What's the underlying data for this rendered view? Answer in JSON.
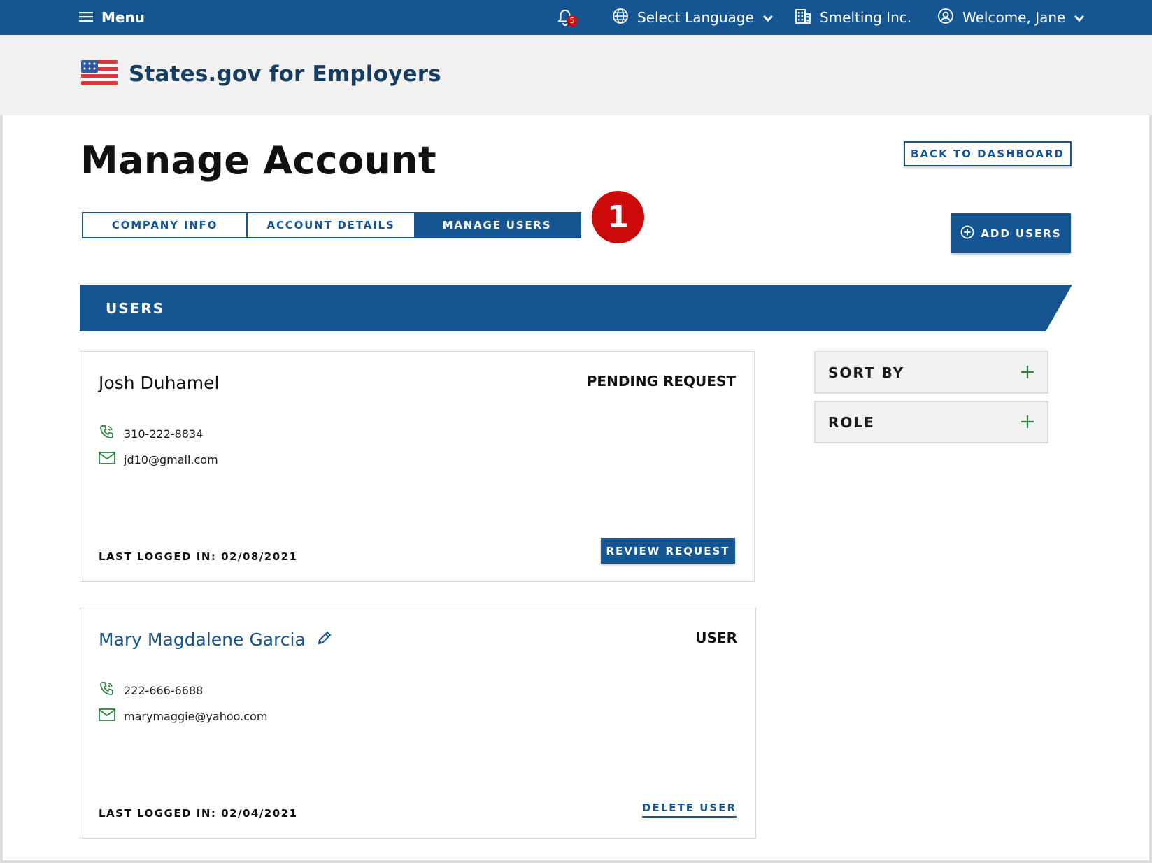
{
  "topbar": {
    "menu_label": "Menu",
    "notification_count": "5",
    "language_label": "Select Language",
    "company_label": "Smelting Inc.",
    "welcome_label": "Welcome, Jane"
  },
  "brand": {
    "title": "States.gov for Employers"
  },
  "page": {
    "title": "Manage Account",
    "back_button": "BACK TO DASHBOARD",
    "add_users_button": "ADD USERS",
    "step_marker": "1"
  },
  "tabs": [
    {
      "label": "COMPANY INFO",
      "active": false
    },
    {
      "label": "ACCOUNT DETAILS",
      "active": false
    },
    {
      "label": "MANAGE USERS",
      "active": true
    }
  ],
  "users_section": {
    "title": "USERS"
  },
  "users": [
    {
      "name": "Josh Duhamel",
      "status": "PENDING REQUEST",
      "phone": "310-222-8834",
      "email": "jd10@gmail.com",
      "last_logged": "LAST LOGGED IN: 02/08/2021",
      "action": "REVIEW REQUEST"
    },
    {
      "name": "Mary Magdalene Garcia",
      "status": "USER",
      "phone": "222-666-6688",
      "email": "marymaggie@yahoo.com",
      "last_logged": "LAST LOGGED IN: 02/04/2021",
      "action": "DELETE USER"
    }
  ],
  "filters": [
    {
      "label": "SORT BY",
      "icon": "plus-icon"
    },
    {
      "label": "ROLE",
      "icon": "plus-icon"
    }
  ],
  "colors": {
    "primary": "#155591",
    "brand_text": "#163c5f",
    "accent_red": "#cc0a0a",
    "icon_green": "#2e8540",
    "band_gray": "#f1f1f1"
  }
}
